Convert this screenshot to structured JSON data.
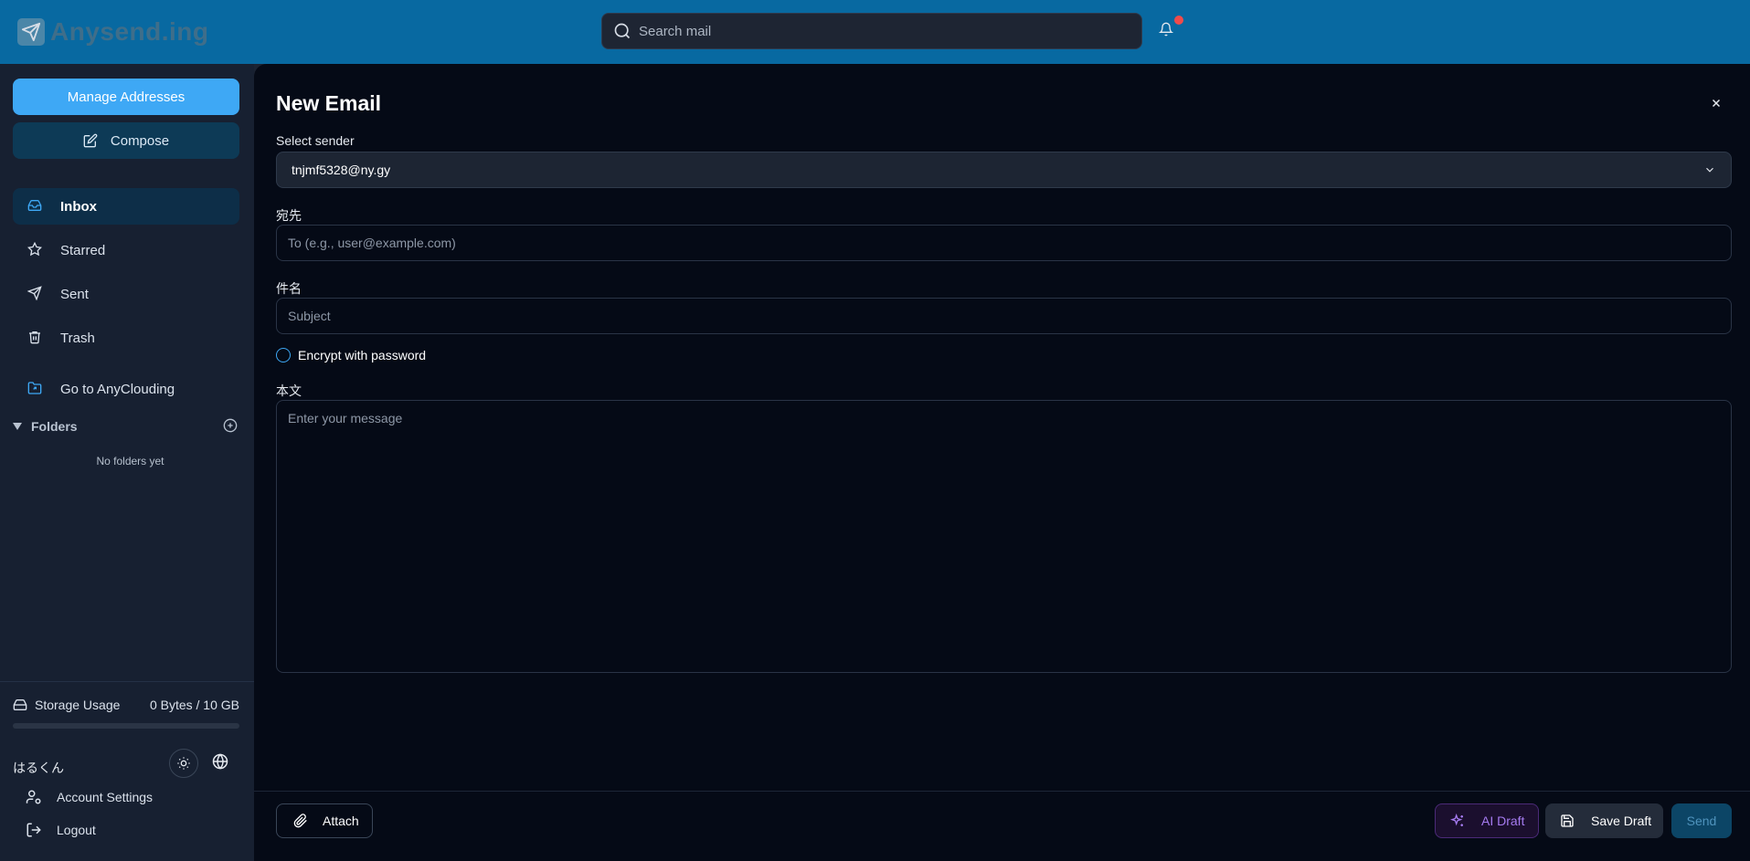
{
  "app": {
    "name": "Anysend.ing"
  },
  "search": {
    "placeholder": "Search mail"
  },
  "sidebar": {
    "manage_addresses": "Manage Addresses",
    "compose": "Compose",
    "nav": [
      {
        "label": "Inbox",
        "icon": "inbox-icon",
        "active": true
      },
      {
        "label": "Starred",
        "icon": "star-icon"
      },
      {
        "label": "Sent",
        "icon": "send-icon"
      },
      {
        "label": "Trash",
        "icon": "trash-icon"
      },
      {
        "label": "Go to AnyClouding",
        "icon": "folder-link-icon"
      }
    ],
    "folders": {
      "label": "Folders",
      "empty": "No folders yet"
    },
    "storage": {
      "label": "Storage Usage",
      "value": "0 Bytes / 10 GB",
      "used_fraction": 0
    },
    "user": {
      "name": "はるくん"
    },
    "account_settings": "Account Settings",
    "logout": "Logout"
  },
  "compose": {
    "title": "New Email",
    "sender": {
      "label": "Select sender",
      "value": "tnjmf5328@ny.gy"
    },
    "to": {
      "label": "宛先",
      "placeholder": "To (e.g., user@example.com)"
    },
    "subject": {
      "label": "件名",
      "placeholder": "Subject"
    },
    "encrypt_label": "Encrypt with password",
    "body": {
      "label": "本文",
      "placeholder": "Enter your message"
    },
    "attach": "Attach",
    "ai_draft": "AI Draft",
    "save_draft": "Save Draft",
    "send": "Send"
  },
  "colors": {
    "header": "#0869a1",
    "accent": "#3ea8f5",
    "sidebar": "#172031",
    "main": "#050a16",
    "ai": "#a57bf0",
    "notification": "#f04b4b"
  }
}
